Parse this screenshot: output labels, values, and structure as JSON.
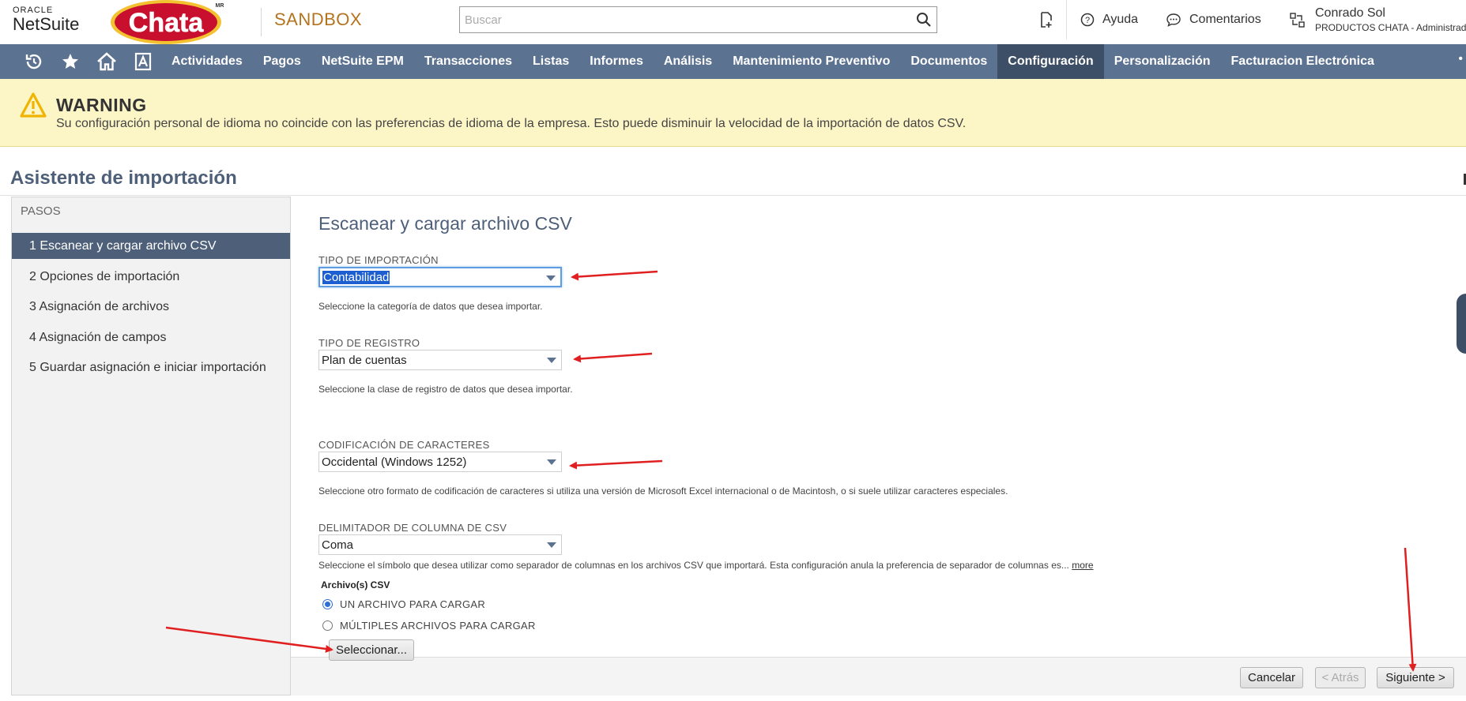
{
  "header": {
    "oracle_text": "ORACLE",
    "netsuite_text": "NetSuite",
    "logo_text": "Chata",
    "logo_mark": "MR",
    "environment": "SANDBOX",
    "search_placeholder": "Buscar",
    "help_label": "Ayuda",
    "comments_label": "Comentarios",
    "user_name": "Conrado Sol",
    "user_role": "PRODUCTOS CHATA - Administrad"
  },
  "nav": {
    "items": [
      {
        "label": "Actividades"
      },
      {
        "label": "Pagos"
      },
      {
        "label": "NetSuite EPM"
      },
      {
        "label": "Transacciones"
      },
      {
        "label": "Listas"
      },
      {
        "label": "Informes"
      },
      {
        "label": "Análisis"
      },
      {
        "label": "Mantenimiento Preventivo"
      },
      {
        "label": "Documentos"
      },
      {
        "label": "Configuración"
      },
      {
        "label": "Personalización"
      },
      {
        "label": "Facturacion Electrónica"
      }
    ],
    "active": "Configuración",
    "more": "•"
  },
  "warning": {
    "title": "WARNING",
    "message": "Su configuración personal de idioma no coincide con las preferencias de idioma de la empresa. Esto puede disminuir la velocidad de la importación de datos CSV."
  },
  "page": {
    "title": "Asistente de importación"
  },
  "steps": {
    "header": "PASOS",
    "items": [
      {
        "label": "1 Escanear y cargar archivo CSV"
      },
      {
        "label": "2 Opciones de importación"
      },
      {
        "label": "3 Asignación de archivos"
      },
      {
        "label": "4 Asignación de campos"
      },
      {
        "label": "5 Guardar asignación e iniciar importación"
      }
    ],
    "active_index": 0
  },
  "form": {
    "section_title": "Escanear y cargar archivo CSV",
    "import_type": {
      "label": "TIPO DE IMPORTACIÓN",
      "value": "Contabilidad",
      "help": "Seleccione la categoría de datos que desea importar."
    },
    "record_type": {
      "label": "TIPO DE REGISTRO",
      "value": "Plan de cuentas",
      "help": "Seleccione la clase de registro de datos que desea importar."
    },
    "encoding": {
      "label": "CODIFICACIÓN DE CARACTERES",
      "value": "Occidental (Windows 1252)",
      "help": "Seleccione otro formato de codificación de caracteres si utiliza una versión de Microsoft Excel internacional o de Macintosh, o si suele utilizar caracteres especiales."
    },
    "delimiter": {
      "label": "DELIMITADOR DE COLUMNA DE CSV",
      "value": "Coma",
      "help": "Seleccione el símbolo que desea utilizar como separador de columnas en los archivos CSV que importará. Esta configuración anula la preferencia de separador de columnas es...",
      "more": "more"
    },
    "csv_files": {
      "label": "Archivo(s) CSV",
      "options": [
        {
          "label": "UN ARCHIVO PARA CARGAR",
          "checked": true
        },
        {
          "label": "MÚLTIPLES ARCHIVOS PARA CARGAR",
          "checked": false
        }
      ],
      "select_button": "Seleccionar..."
    }
  },
  "actions": {
    "cancel": "Cancelar",
    "back": "< Atrás",
    "next": "Siguiente >"
  },
  "colors": {
    "nav_bg": "#5c7291",
    "nav_active": "#3d4f66",
    "warning_bg": "#fcf6c7",
    "title_color": "#4d5f79",
    "annotation_arrow": "#e02020"
  }
}
